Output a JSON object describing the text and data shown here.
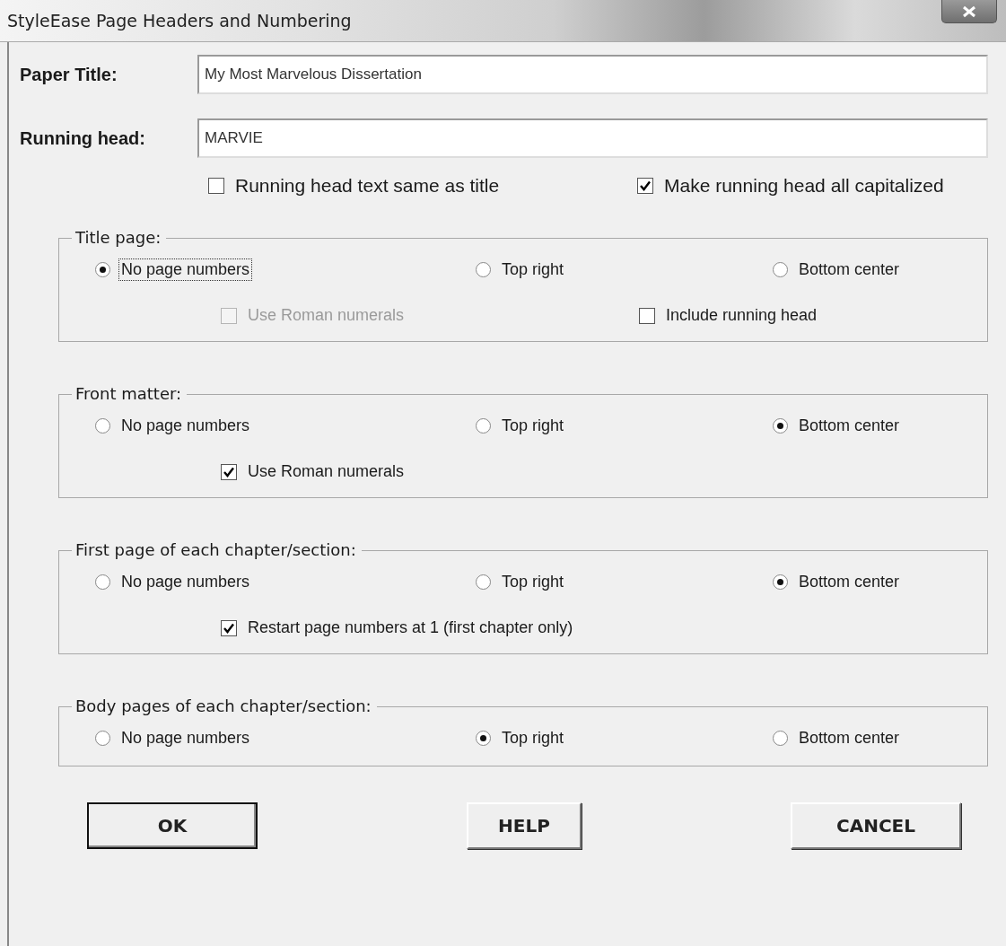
{
  "window": {
    "title": "StyleEase Page Headers and Numbering"
  },
  "fields": [
    {
      "label": "Paper Title:",
      "value": "My Most Marvelous Dissertation"
    },
    {
      "label": "Running head:",
      "value": "MARVIE"
    }
  ],
  "options": [
    {
      "label": "Running head text same as title",
      "checked": false
    },
    {
      "label": "Make running head all capitalized",
      "checked": true
    }
  ],
  "groups": [
    {
      "title": "Title page:",
      "radios": [
        {
          "label": "No page numbers",
          "selected": true,
          "focused": true
        },
        {
          "label": "Top right",
          "selected": false,
          "focused": false
        },
        {
          "label": "Bottom center",
          "selected": false,
          "focused": false
        }
      ],
      "checkboxes": [
        {
          "label": "Use Roman numerals",
          "checked": false,
          "disabled": true
        },
        {
          "label": "Include running head",
          "checked": false,
          "disabled": false
        }
      ]
    },
    {
      "title": "Front matter:",
      "radios": [
        {
          "label": "No page numbers",
          "selected": false,
          "focused": false
        },
        {
          "label": "Top right",
          "selected": false,
          "focused": false
        },
        {
          "label": "Bottom center",
          "selected": true,
          "focused": false
        }
      ],
      "checkboxes": [
        {
          "label": "Use Roman numerals",
          "checked": true,
          "disabled": false
        }
      ]
    },
    {
      "title": "First page of each chapter/section:",
      "radios": [
        {
          "label": "No page numbers",
          "selected": false,
          "focused": false
        },
        {
          "label": "Top right",
          "selected": false,
          "focused": false
        },
        {
          "label": "Bottom center",
          "selected": true,
          "focused": false
        }
      ],
      "checkboxes": [
        {
          "label": "Restart page numbers at 1  (first chapter only)",
          "checked": true,
          "disabled": false
        }
      ]
    },
    {
      "title": "Body pages of each chapter/section:",
      "radios": [
        {
          "label": "No page numbers",
          "selected": false,
          "focused": false
        },
        {
          "label": "Top right",
          "selected": true,
          "focused": false
        },
        {
          "label": "Bottom center",
          "selected": false,
          "focused": false
        }
      ]
    }
  ],
  "buttons": [
    {
      "label": "OK",
      "default": true
    },
    {
      "label": "HELP",
      "default": false
    },
    {
      "label": "CANCEL",
      "default": false
    }
  ]
}
